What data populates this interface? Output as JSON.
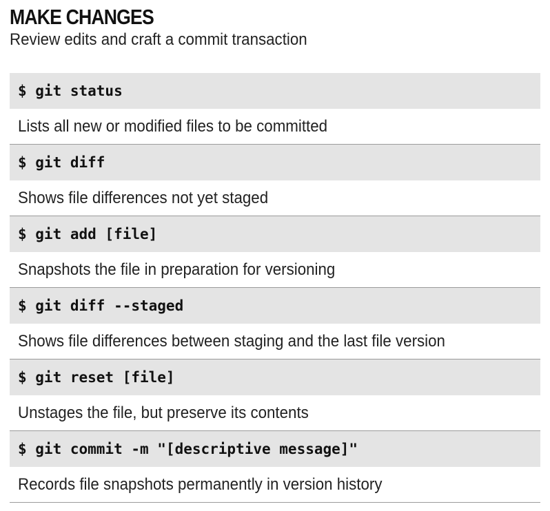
{
  "heading": {
    "title": "MAKE CHANGES",
    "subtitle": "Review edits and craft a commit transaction"
  },
  "commands": [
    {
      "command": "$ git status",
      "description": "Lists all new or modified files to be committed"
    },
    {
      "command": "$ git diff",
      "description": "Shows file differences not yet staged"
    },
    {
      "command": "$ git add [file]",
      "description": "Snapshots the file in preparation for versioning"
    },
    {
      "command": "$ git diff --staged",
      "description": "Shows file differences between staging and the last file version"
    },
    {
      "command": "$ git reset [file]",
      "description": "Unstages the file, but preserve its contents"
    },
    {
      "command": "$ git commit -m \"[descriptive message]\"",
      "description": "Records file snapshots permanently in version history"
    }
  ],
  "colors": {
    "command_background": "#e4e4e4",
    "divider": "#9a9a9a",
    "text": "#111111"
  }
}
